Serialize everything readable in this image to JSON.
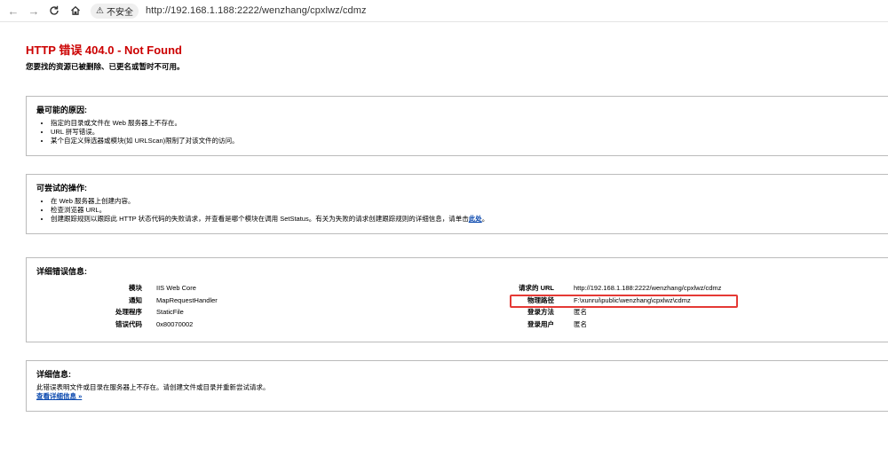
{
  "browser": {
    "back_icon": "back-arrow-icon",
    "forward_icon": "forward-arrow-icon",
    "reload_icon": "reload-icon",
    "home_icon": "home-icon",
    "security_label": "不安全",
    "url": "http://192.168.1.188:2222/wenzhang/cpxlwz/cdmz"
  },
  "page": {
    "title": "HTTP 错误 404.0 - Not Found",
    "subtitle": "您要找的资源已被删除、已更名或暂时不可用。"
  },
  "causes": {
    "heading": "最可能的原因:",
    "items": [
      "指定的目录或文件在 Web 服务器上不存在。",
      "URL 拼写错误。",
      "某个自定义筛选器或模块(如 URLScan)限制了对该文件的访问。"
    ]
  },
  "actions": {
    "heading": "可尝试的操作:",
    "items": [
      "在 Web 服务器上创建内容。",
      "检查浏览器 URL。"
    ],
    "item3_text": "创建跟踪规则以跟踪此 HTTP 状态代码的失败请求，并查看是哪个模块在调用 SetStatus。有关为失败的请求创建跟踪规则的详细信息，请单击",
    "item3_link": "此处",
    "item3_end": "。"
  },
  "details": {
    "heading": "详细错误信息:",
    "left": [
      {
        "label": "模块",
        "value": "IIS Web Core"
      },
      {
        "label": "通知",
        "value": "MapRequestHandler"
      },
      {
        "label": "处理程序",
        "value": "StaticFile"
      },
      {
        "label": "错误代码",
        "value": "0x80070002"
      }
    ],
    "right": [
      {
        "label": "请求的 URL",
        "value": "http://192.168.1.188:2222/wenzhang/cpxlwz/cdmz"
      },
      {
        "label": "物理路径",
        "value": "F:\\xunrui\\public\\wenzhang\\cpxlwz\\cdmz"
      },
      {
        "label": "登录方法",
        "value": "匿名"
      },
      {
        "label": "登录用户",
        "value": "匿名"
      }
    ]
  },
  "more_info": {
    "heading": "详细信息:",
    "text": "此错误表明文件或目录在服务器上不存在。请创建文件或目录并重新尝试请求。",
    "link": "查看详细信息 »"
  },
  "colors": {
    "title": "#cc0000",
    "highlight_border": "#e53935",
    "link": "#0645ad"
  }
}
